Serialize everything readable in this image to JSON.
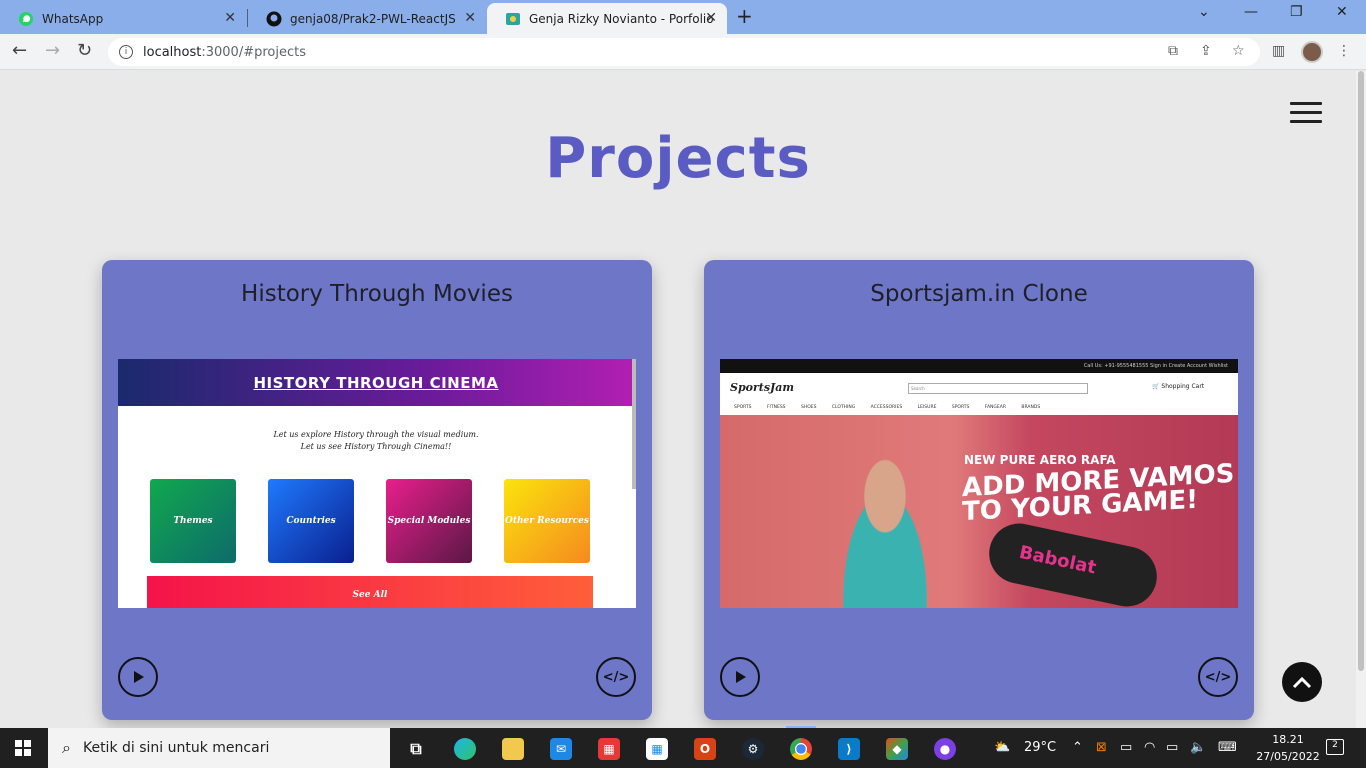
{
  "browser": {
    "tabs": [
      {
        "title": "WhatsApp"
      },
      {
        "title": "genja08/Prak2-PWL-ReactJS"
      },
      {
        "title": "Genja Rizky Novianto - Porfolio"
      }
    ],
    "url_host": "localhost",
    "url_rest": ":3000/#projects"
  },
  "page": {
    "heading": "Projects",
    "projects": [
      {
        "title": "History Through Movies",
        "preview": {
          "header": "HISTORY THROUGH CINEMA",
          "sub1": "Let us explore History through the visual medium.",
          "sub2": "Let us see History Through Cinema!!",
          "tiles": [
            "Themes",
            "Countries",
            "Special Modules",
            "Other Resources"
          ],
          "see_all": "See All"
        }
      },
      {
        "title": "Sportsjam.in Clone",
        "preview": {
          "topbar": "Call Us: +91-9555481555   Sign in   Create Account   Wishlist",
          "logo": "SportsJam",
          "search_placeholder": "Search",
          "cart": "Shopping Cart",
          "menu": "SPORTS FITNESS SHOES CLOTHING ACCESSORIES LEISURE SPORTS FANGEAR BRANDS",
          "banner_line1": "NEW PURE AERO RAFA",
          "banner_line2": "ADD MORE VAMOS",
          "banner_line3": "TO YOUR GAME!",
          "bag_text": "Babolat"
        }
      }
    ]
  },
  "taskbar": {
    "search_placeholder": "Ketik di sini untuk mencari",
    "weather": "29°C",
    "time": "18.21",
    "date": "27/05/2022",
    "notification_count": "2"
  }
}
